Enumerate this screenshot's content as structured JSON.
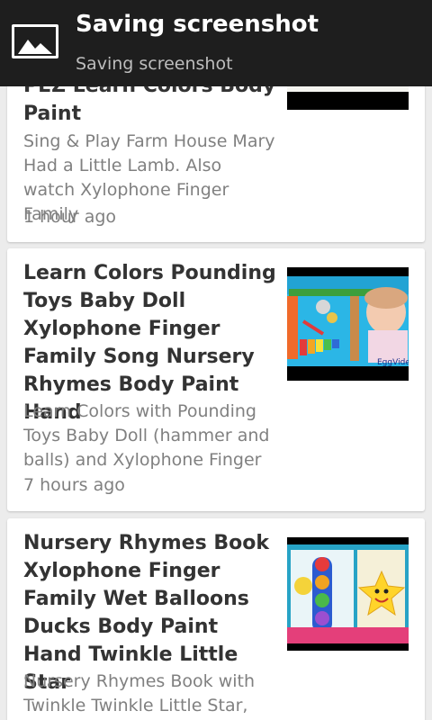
{
  "notification": {
    "title": "Saving screenshot",
    "subtitle": "Saving screenshot",
    "icon": "image-icon"
  },
  "feed": {
    "items": [
      {
        "title": "PEZ Learn Colors Body Paint",
        "description": "Sing & Play Farm House Mary Had a Little Lamb. Also watch Xylophone Finger Family",
        "time": "1 hour ago"
      },
      {
        "title": "Learn Colors Pounding Toys Baby Doll Xylophone Finger Family Song Nursery Rhymes Body Paint Hand",
        "description": "Learn Colors with Pounding Toys Baby Doll (hammer and balls) and Xylophone Finger",
        "time": "7 hours ago",
        "thumb_text": "EggVideos.com"
      },
      {
        "title": "Nursery Rhymes Book Xylophone Finger Family Wet Balloons Ducks Body Paint Hand Twinkle Little Star",
        "description": "Nursery Rhymes Book with Twinkle Twinkle Little Star,",
        "time": ""
      }
    ]
  },
  "colors": {
    "status_bar": "#1e1e1e",
    "background": "#ececec",
    "card": "#ffffff",
    "title_text": "#333333",
    "secondary_text": "#808080"
  }
}
